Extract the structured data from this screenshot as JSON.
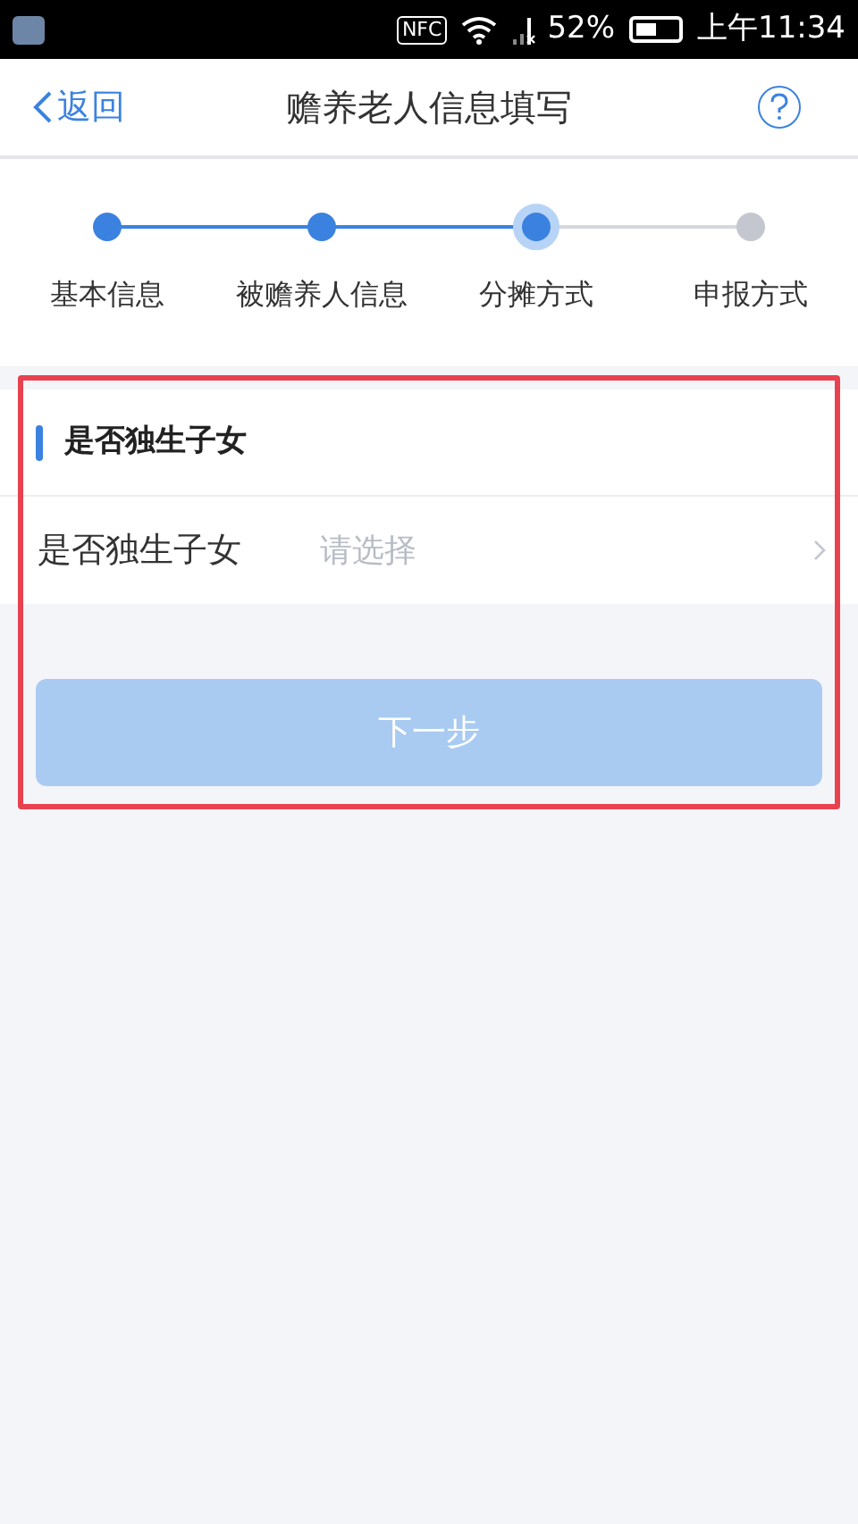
{
  "status_bar": {
    "nfc": "NFC",
    "battery": "52%",
    "time": "上午11:34"
  },
  "nav": {
    "back": "返回",
    "title": "赡养老人信息填写"
  },
  "steps": [
    {
      "label": "基本信息",
      "completed": true,
      "selected": false
    },
    {
      "label": "被赡养人信息",
      "completed": true,
      "selected": false
    },
    {
      "label": "分摊方式",
      "completed": false,
      "selected": true
    },
    {
      "label": "申报方式",
      "completed": false,
      "selected": false
    }
  ],
  "section": {
    "title": "是否独生子女",
    "field": {
      "label": "是否独生子女",
      "placeholder": "请选择"
    }
  },
  "next_button": {
    "label": "下一步",
    "disabled": true
  },
  "highlight": {
    "kind": "annotation-frame",
    "color": "#e8424f"
  }
}
